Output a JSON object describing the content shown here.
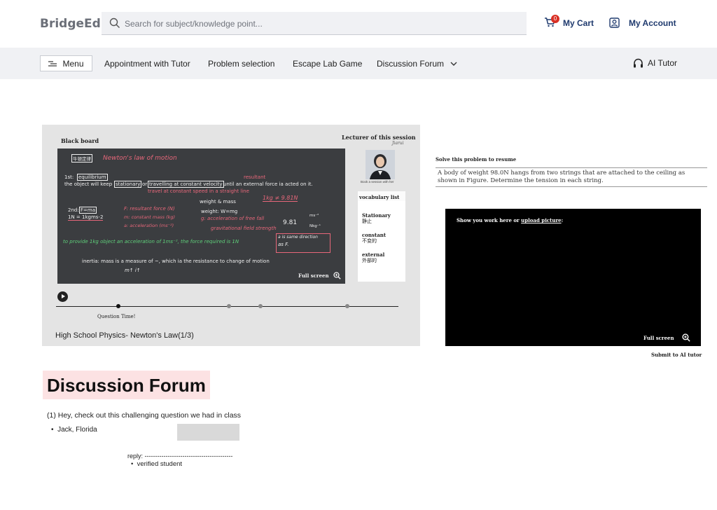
{
  "header": {
    "logo": "BridgeEd",
    "search_placeholder": "Search for subject/knowledge point...",
    "cart_label": "My Cart",
    "cart_count": "0",
    "account_label": "My Account"
  },
  "nav": {
    "menu_label": "Menu",
    "links": [
      "Appointment with Tutor",
      "Problem selection",
      "Escape Lab Game",
      "Discussion Forum"
    ],
    "ai_tutor_label": "AI Tutor"
  },
  "video": {
    "blackboard_label": "Black board",
    "lecturer_label": "Lecturer of this session",
    "lecturer_signature": "Jiarui",
    "book_session_caption": "Book a session with her",
    "board": {
      "title_cn": "牛顿定律",
      "title_hand": "Newton's law of motion",
      "first_law": "1st:",
      "equilibrium": "equilibrium",
      "resultant": "resultant",
      "line2_a": "the object will keep",
      "stationary": "stationary",
      "or": "or",
      "constant_velocity": "travelling at constant velocity",
      "line2_b": "until an external force ia acted on it.",
      "constant_speed_note": "travel at constant speed in a straight line",
      "weight_mass": "weight & mass",
      "kg_note": "1kg ≠ 9.81N",
      "second_law": "2nd:",
      "fma": "F=ma",
      "newton_def": "1N = 1kgms-2",
      "f_def": "F: resultant force (N)",
      "m_def": "m: constant mass (kg)",
      "a_def": "a: acceleration (ms⁻²)",
      "weight_formula": "weight: W=mg",
      "g_def1": "g: acceleration of free fall",
      "g_def2": "gravitational field strength",
      "g_value": "9.81",
      "g_unit1": "ms⁻²",
      "g_unit2": "Nkg⁻¹",
      "green_note": "to provide 1kg object an acceleration of 1ms⁻², the force required is 1N",
      "box_note1": "a is same direction",
      "box_note2": "as F.",
      "inertia": "inertia:  mass is a measure of ~, which ia the resistance to change of motion",
      "inertia_hand": "m↑ i↑",
      "fullscreen": "Full screen"
    },
    "vocab_title": "vocabulary list",
    "vocab": [
      {
        "en": "Stationary",
        "cn": "静止"
      },
      {
        "en": "constant",
        "cn": "不变的"
      },
      {
        "en": "external",
        "cn": "外部的"
      }
    ],
    "question_time": "Question Time!",
    "title": "High School Physics- Newton's Law(1/3)"
  },
  "problem": {
    "solve_label": "Solve this problem to resume",
    "text": "A body of weight 98.0N hangs from two strings that are attached to the ceiling as shown in Figure. Determine the tension in each string.",
    "work_label_prefix": "Show you work here or ",
    "work_label_link": "upload picture",
    "work_label_suffix": ":",
    "fullscreen": "Full screen",
    "submit": "Submit to AI tutor"
  },
  "forum": {
    "title": "Discussion Forum",
    "post": "(1) Hey, check out this challenging question we had in class",
    "author": "Jack, Florida",
    "reply": "reply: ------------------------------------------",
    "verified": "verified student"
  },
  "colors": {
    "brand_blue": "#1f3a6e",
    "badge_red": "#d93025",
    "forum_highlight": "#fce2e3",
    "blackboard": "#3b3d40"
  }
}
